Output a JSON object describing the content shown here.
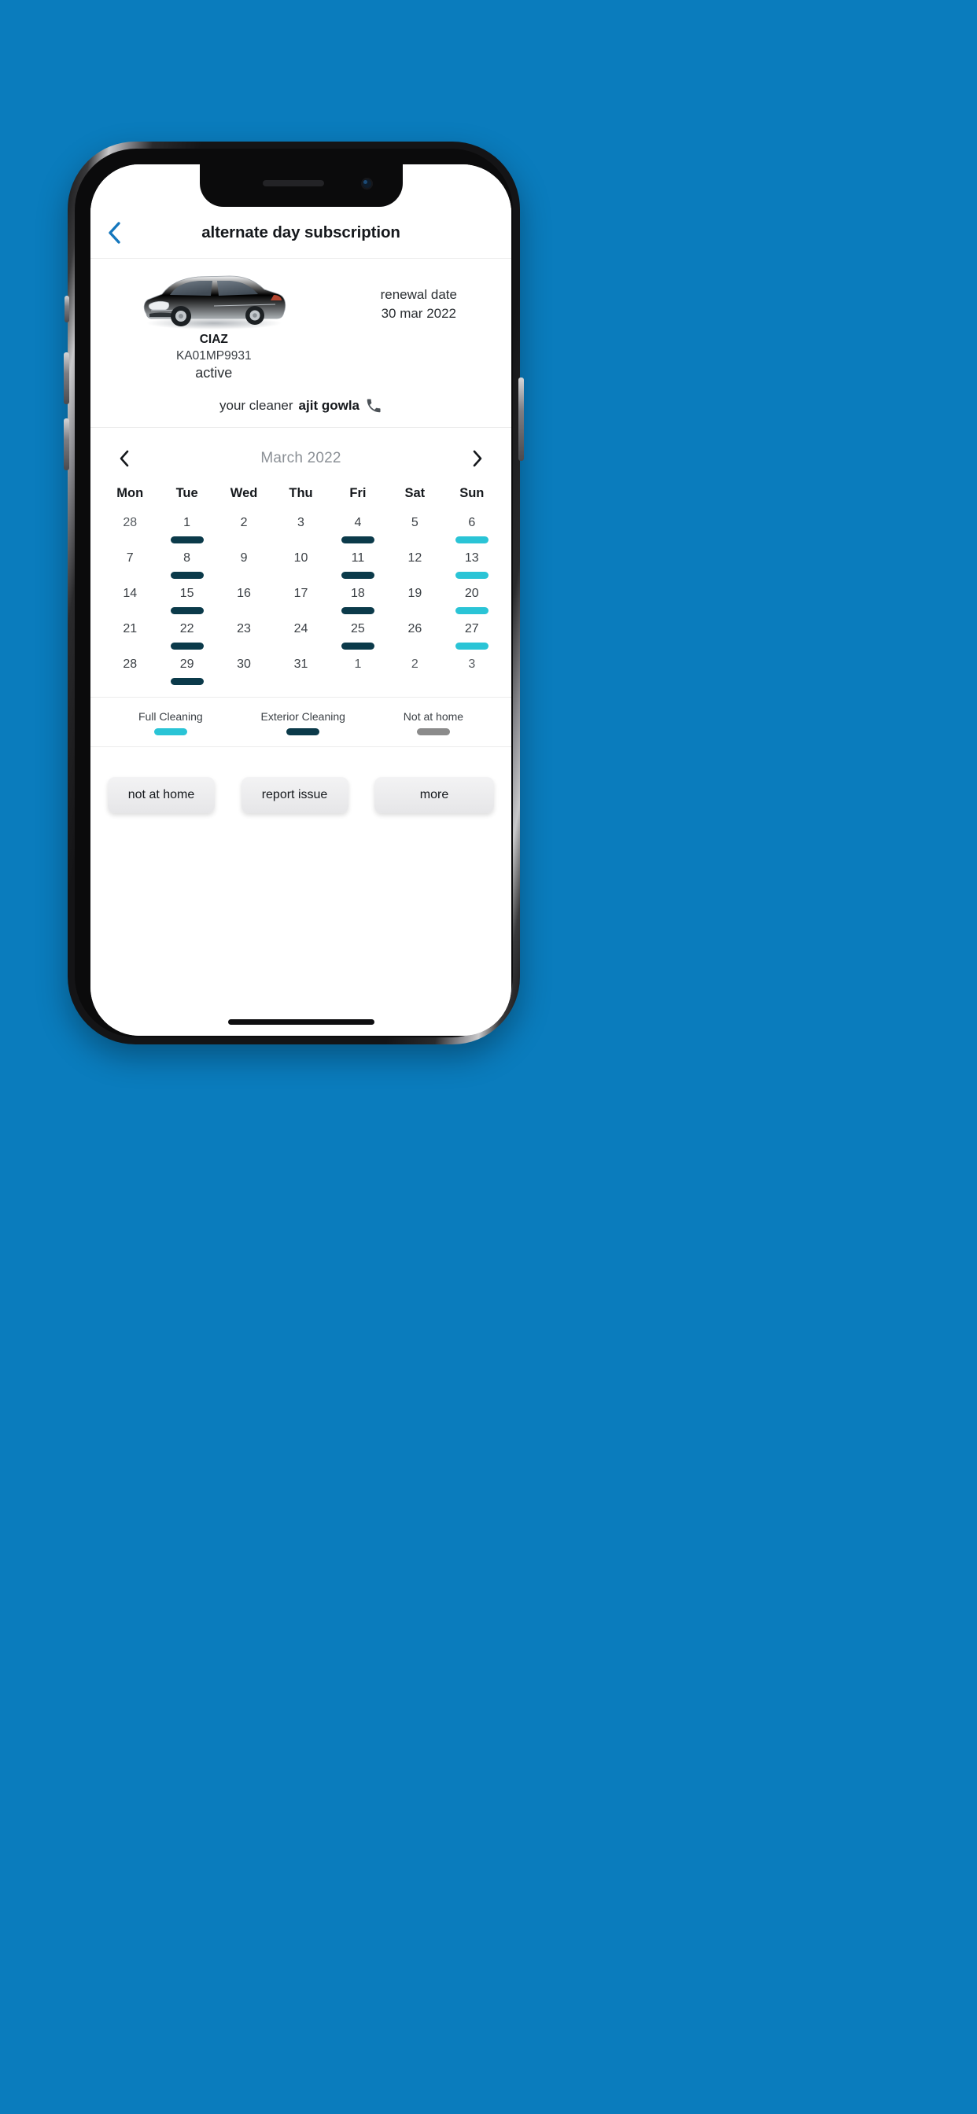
{
  "background_color": "#0a7cbd",
  "header": {
    "back_icon": "chevron-left-icon",
    "title": "alternate day subscription"
  },
  "vehicle": {
    "image_alt": "silver-sedan-car",
    "name": "CIAZ",
    "plate": "KA01MP9931",
    "status": "active",
    "renewal_label": "renewal date",
    "renewal_date": "30 mar 2022"
  },
  "cleaner": {
    "prefix": "your cleaner",
    "name": "ajit gowla",
    "call_icon": "phone-icon"
  },
  "calendar": {
    "prev_icon": "chevron-left-icon",
    "next_icon": "chevron-right-icon",
    "month_label": "March 2022",
    "day_headers": [
      "Mon",
      "Tue",
      "Wed",
      "Thu",
      "Fri",
      "Sat",
      "Sun"
    ],
    "weeks": [
      [
        {
          "day": "28",
          "mark": "none",
          "outside": true
        },
        {
          "day": "1",
          "mark": "exterior",
          "outside": false
        },
        {
          "day": "2",
          "mark": "none",
          "outside": false
        },
        {
          "day": "3",
          "mark": "none",
          "outside": false
        },
        {
          "day": "4",
          "mark": "exterior",
          "outside": false
        },
        {
          "day": "5",
          "mark": "none",
          "outside": false
        },
        {
          "day": "6",
          "mark": "full",
          "outside": false
        }
      ],
      [
        {
          "day": "7",
          "mark": "none",
          "outside": false
        },
        {
          "day": "8",
          "mark": "exterior",
          "outside": false
        },
        {
          "day": "9",
          "mark": "none",
          "outside": false
        },
        {
          "day": "10",
          "mark": "none",
          "outside": false
        },
        {
          "day": "11",
          "mark": "exterior",
          "outside": false
        },
        {
          "day": "12",
          "mark": "none",
          "outside": false
        },
        {
          "day": "13",
          "mark": "full",
          "outside": false
        }
      ],
      [
        {
          "day": "14",
          "mark": "none",
          "outside": false
        },
        {
          "day": "15",
          "mark": "exterior",
          "outside": false
        },
        {
          "day": "16",
          "mark": "none",
          "outside": false
        },
        {
          "day": "17",
          "mark": "none",
          "outside": false
        },
        {
          "day": "18",
          "mark": "exterior",
          "outside": false
        },
        {
          "day": "19",
          "mark": "none",
          "outside": false
        },
        {
          "day": "20",
          "mark": "full",
          "outside": false
        }
      ],
      [
        {
          "day": "21",
          "mark": "none",
          "outside": false
        },
        {
          "day": "22",
          "mark": "exterior",
          "outside": false
        },
        {
          "day": "23",
          "mark": "none",
          "outside": false
        },
        {
          "day": "24",
          "mark": "none",
          "outside": false
        },
        {
          "day": "25",
          "mark": "exterior",
          "outside": false
        },
        {
          "day": "26",
          "mark": "none",
          "outside": false
        },
        {
          "day": "27",
          "mark": "full",
          "outside": false
        }
      ],
      [
        {
          "day": "28",
          "mark": "none",
          "outside": false
        },
        {
          "day": "29",
          "mark": "exterior",
          "outside": false
        },
        {
          "day": "30",
          "mark": "none",
          "outside": false
        },
        {
          "day": "31",
          "mark": "none",
          "outside": false
        },
        {
          "day": "1",
          "mark": "none",
          "outside": true
        },
        {
          "day": "2",
          "mark": "none",
          "outside": true
        },
        {
          "day": "3",
          "mark": "none",
          "outside": true
        }
      ]
    ]
  },
  "legend": [
    {
      "label": "Full Cleaning",
      "color": "#2ac4d6",
      "key": "full"
    },
    {
      "label": "Exterior Cleaning",
      "color": "#0b3a4a",
      "key": "exterior"
    },
    {
      "label": "Not at home",
      "color": "#8b8b8b",
      "key": "nothome"
    }
  ],
  "actions": [
    {
      "label": "not at home"
    },
    {
      "label": "report issue"
    },
    {
      "label": "more"
    }
  ]
}
